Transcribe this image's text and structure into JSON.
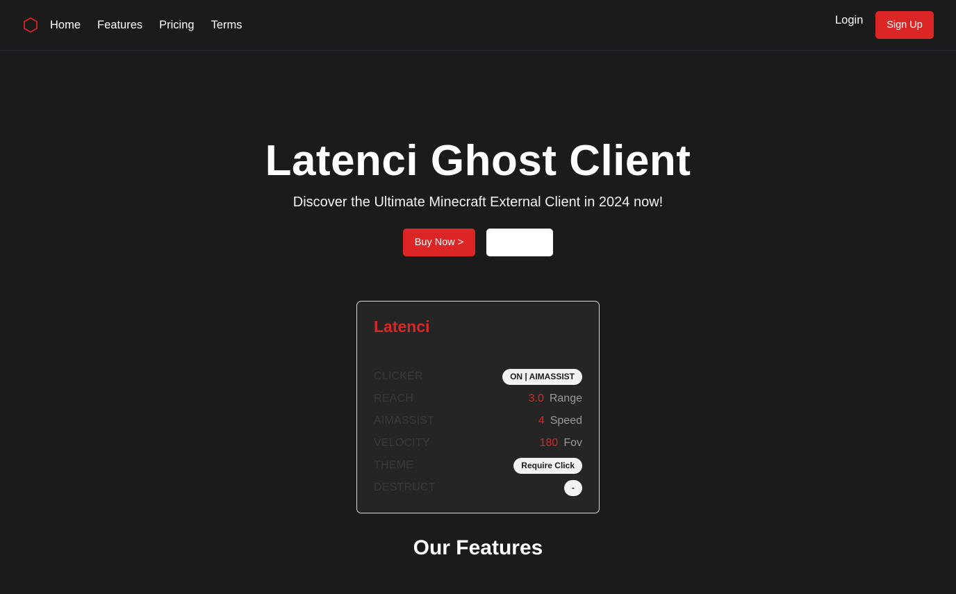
{
  "nav": {
    "links": [
      "Home",
      "Features",
      "Pricing",
      "Terms"
    ],
    "login": "Login",
    "signup": "Sign Up"
  },
  "hero": {
    "title": "Latenci Ghost Client",
    "subtitle": "Discover the Ultimate Minecraft External Client in 2024 now!",
    "buy_label": "Buy Now >",
    "secondary_label": ""
  },
  "card": {
    "title": "Latenci",
    "rows": [
      {
        "label": "CLICKER",
        "pill": "ON | AIMASSIST"
      },
      {
        "label": "REACH",
        "value": "3.0",
        "unit": "Range"
      },
      {
        "label": "AIMASSIST",
        "value": "4",
        "unit": "Speed"
      },
      {
        "label": "VELOCITY",
        "value": "180",
        "unit": "Fov"
      },
      {
        "label": "THEME",
        "pill": "Require Click"
      },
      {
        "label": "DESTRUCT",
        "pill": "-"
      }
    ]
  },
  "features": {
    "title": "Our Features"
  },
  "colors": {
    "background": "#1b1b1c",
    "accent": "#dc2626",
    "card": "#252526"
  },
  "icons": {
    "logo": "hexagon-icon"
  }
}
